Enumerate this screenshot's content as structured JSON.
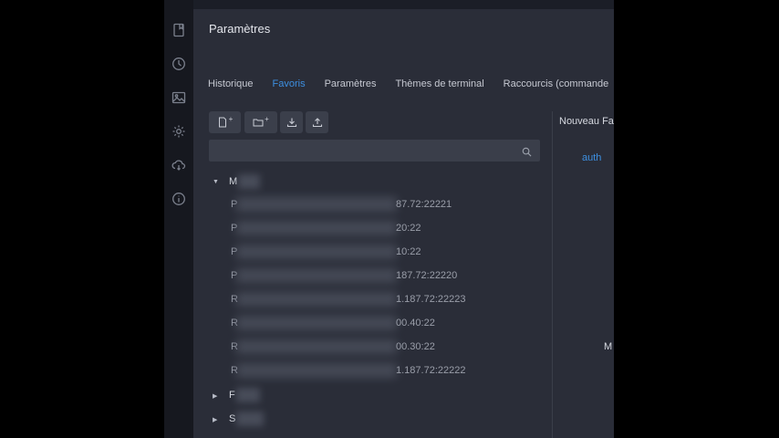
{
  "window": {
    "title": "Paramètres"
  },
  "sidebar": {
    "icons": [
      "bookmark-icon",
      "clock-icon",
      "image-icon",
      "gear-icon",
      "cloud-sync-icon",
      "info-icon"
    ]
  },
  "tabs": [
    {
      "label": "Historique",
      "active": false
    },
    {
      "label": "Favoris",
      "active": true
    },
    {
      "label": "Paramètres",
      "active": false
    },
    {
      "label": "Thèmes de terminal",
      "active": false
    },
    {
      "label": "Raccourcis (commande",
      "active": false
    }
  ],
  "toolbar": {
    "buttons": [
      "new-bookmark",
      "new-folder",
      "import",
      "export"
    ],
    "plus_glyph": "+"
  },
  "search": {
    "value": "",
    "placeholder": ""
  },
  "tree": {
    "groups": [
      {
        "name": "M",
        "expanded": true,
        "items": [
          {
            "name": "P",
            "address": "87.72:22221"
          },
          {
            "name": "P",
            "address": "20:22"
          },
          {
            "name": "P",
            "address": "10:22"
          },
          {
            "name": "P",
            "address": "187.72:22220"
          },
          {
            "name": "R",
            "address": "1.187.72:22223"
          },
          {
            "name": "R",
            "address": "00.40:22"
          },
          {
            "name": "R",
            "address": "00.30:22"
          },
          {
            "name": "R",
            "address": "1.187.72:22222"
          }
        ]
      },
      {
        "name": "F",
        "expanded": false,
        "items": []
      },
      {
        "name": "S",
        "expanded": false,
        "items": []
      }
    ],
    "caret_expanded": "▼",
    "caret_collapsed": "▶"
  },
  "right_panel": {
    "title": "Nouveau Fav",
    "tab_label": "auth",
    "partial_label": "M"
  },
  "colors": {
    "accent": "#3d8fe0",
    "panel": "#2a2d38",
    "background": "#1b1e27"
  }
}
